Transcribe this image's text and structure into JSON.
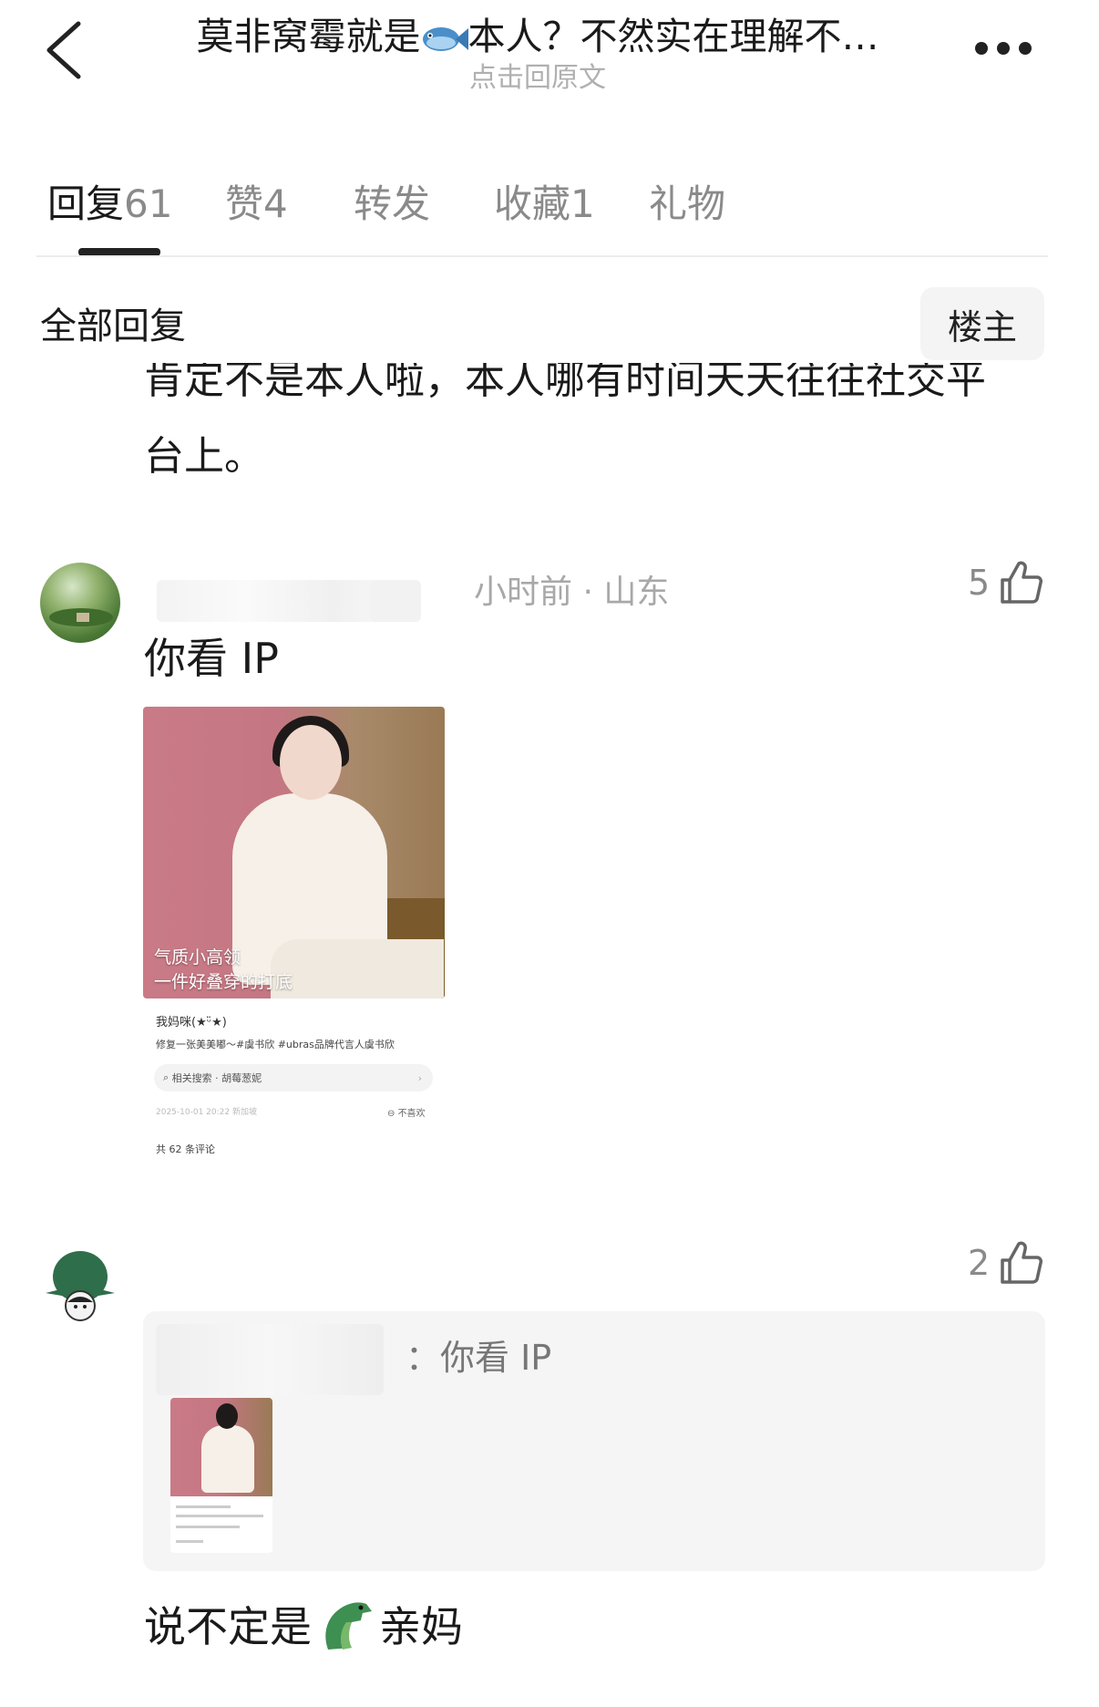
{
  "header": {
    "title_before_icon": "莫非窝霉就是",
    "title_icon": "fish-icon",
    "title_after_icon": "本人？不然实在理解不…",
    "subtitle": "点击回原文"
  },
  "tabs": [
    {
      "label": "回复",
      "count": "61",
      "active": true
    },
    {
      "label": "赞",
      "count": "4",
      "active": false
    },
    {
      "label": "转发",
      "count": "",
      "active": false
    },
    {
      "label": "收藏",
      "count": "1",
      "active": false
    },
    {
      "label": "礼物",
      "count": "",
      "active": false
    }
  ],
  "filter": {
    "label": "全部回复",
    "owner_button": "楼主"
  },
  "prev_comment": {
    "line1": "肯定不是本人啦，本人哪有时间天天往往社交平",
    "line2": "台上。"
  },
  "comments": [
    {
      "meta": "小时前 · 山东",
      "likes": "5",
      "text": "你看 IP",
      "screenshot": {
        "caption_line1": "气质小高领",
        "caption_line2": "一件好叠穿的打底",
        "user": "我妈咪(★ᵕ̈★)",
        "desc": "修复一张美美嘟～#虞书欣 #ubras品牌代言人虞书欣",
        "search": "相关搜索 · 胡莓葱妮",
        "date": "2025-10-01 20:22 新加坡",
        "dislike": "不喜欢",
        "total": "共 62 条评论"
      }
    },
    {
      "likes": "2",
      "quote": "：你看 IP",
      "text_before_icon": "说不定是",
      "text_icon": "crocodile-icon",
      "text_after_icon": "亲妈"
    }
  ],
  "colors": {
    "text_primary": "#1a1a1a",
    "text_secondary": "#8a8a8a",
    "meta_gray": "#a8a8a8",
    "quote_bg": "#f5f5f5",
    "tab_indicator": "#222222"
  }
}
